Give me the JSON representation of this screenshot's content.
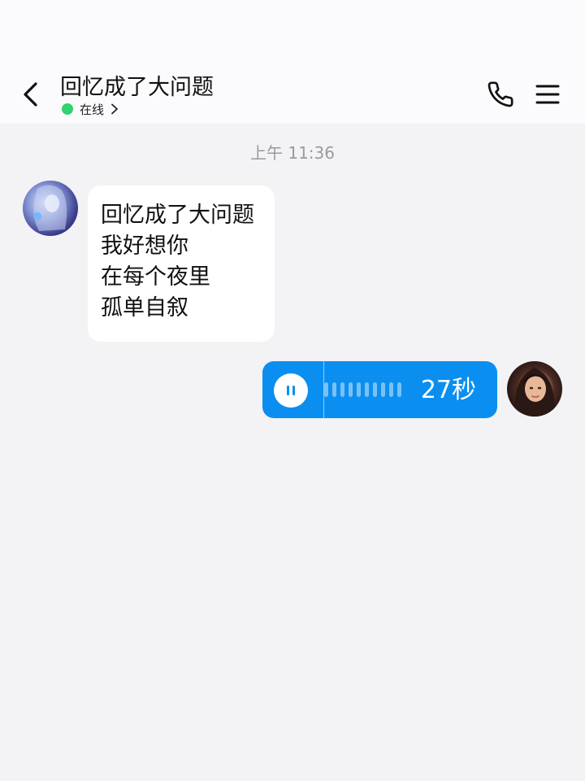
{
  "header": {
    "title": "回忆成了大问题",
    "status": "在线",
    "status_color": "#2fd36f",
    "back_icon": "chevron-left-icon",
    "call_icon": "phone-icon",
    "menu_icon": "menu-icon"
  },
  "chat": {
    "timestamp": "上午 11:36",
    "incoming": {
      "lines": [
        "回忆成了大问题",
        "我好想你",
        "在每个夜里",
        "孤单自叙"
      ]
    },
    "outgoing_voice": {
      "duration": "27秒",
      "state_icon": "pause-icon",
      "bubble_color": "#0a8ff0"
    }
  },
  "colors": {
    "background": "#f3f2f5",
    "header_bg": "#fbfbfd",
    "incoming_bubble": "#ffffff"
  }
}
